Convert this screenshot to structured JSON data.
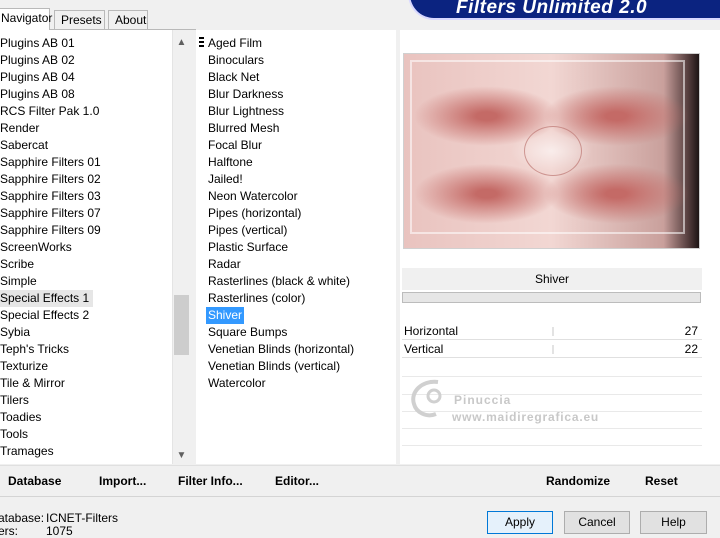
{
  "tabs": [
    {
      "label": "Navigator",
      "active": true
    },
    {
      "label": "Presets",
      "active": false
    },
    {
      "label": "About",
      "active": false
    }
  ],
  "banner": {
    "title": "Filters Unlimited 2.0"
  },
  "categories": {
    "items": [
      "Plugins AB 01",
      "Plugins AB 02",
      "Plugins AB 04",
      "Plugins AB 08",
      "RCS Filter Pak 1.0",
      "Render",
      "Sabercat",
      "Sapphire Filters 01",
      "Sapphire Filters 02",
      "Sapphire Filters 03",
      "Sapphire Filters 07",
      "Sapphire Filters 09",
      "ScreenWorks",
      "Scribe",
      "Simple",
      "Special Effects 1",
      "Special Effects 2",
      "Sybia",
      "Teph's Tricks",
      "Texturize",
      "Tile & Mirror",
      "Tilers",
      "Toadies",
      "Tools",
      "Tramages"
    ],
    "selected": "Special Effects 1",
    "scroll": {
      "up": "▲",
      "down": "▼",
      "position": 0.73
    }
  },
  "filters": {
    "items": [
      "Aged Film",
      "Binoculars",
      "Black Net",
      "Blur Darkness",
      "Blur Lightness",
      "Blurred Mesh",
      "Focal Blur",
      "Halftone",
      "Jailed!",
      "Neon Watercolor",
      "Pipes (horizontal)",
      "Pipes (vertical)",
      "Plastic Surface",
      "Radar",
      "Rasterlines (black & white)",
      "Rasterlines (color)",
      "Shiver",
      "Square Bumps",
      "Venetian Blinds (horizontal)",
      "Venetian Blinds (vertical)",
      "Watercolor"
    ],
    "selected": "Shiver"
  },
  "preview": {
    "filter_name": "Shiver",
    "params": [
      {
        "label": "Horizontal",
        "value": "27"
      },
      {
        "label": "Vertical",
        "value": "22"
      }
    ]
  },
  "watermark": {
    "line1": "Pinuccia",
    "line2": "www.maidiregrafica.eu"
  },
  "toolbar": {
    "database": "Database",
    "import": "Import...",
    "filter_info": "Filter Info...",
    "editor": "Editor...",
    "randomize": "Randomize",
    "reset": "Reset"
  },
  "status": {
    "database_label": "atabase:",
    "database_value": "ICNET-Filters",
    "filters_label": "ers:",
    "filters_value": "1075"
  },
  "buttons": {
    "apply": "Apply",
    "cancel": "Cancel",
    "help": "Help"
  },
  "colors": {
    "banner": "#0b2380",
    "selection": "#3399ff",
    "preview_red": "#c46a66"
  }
}
